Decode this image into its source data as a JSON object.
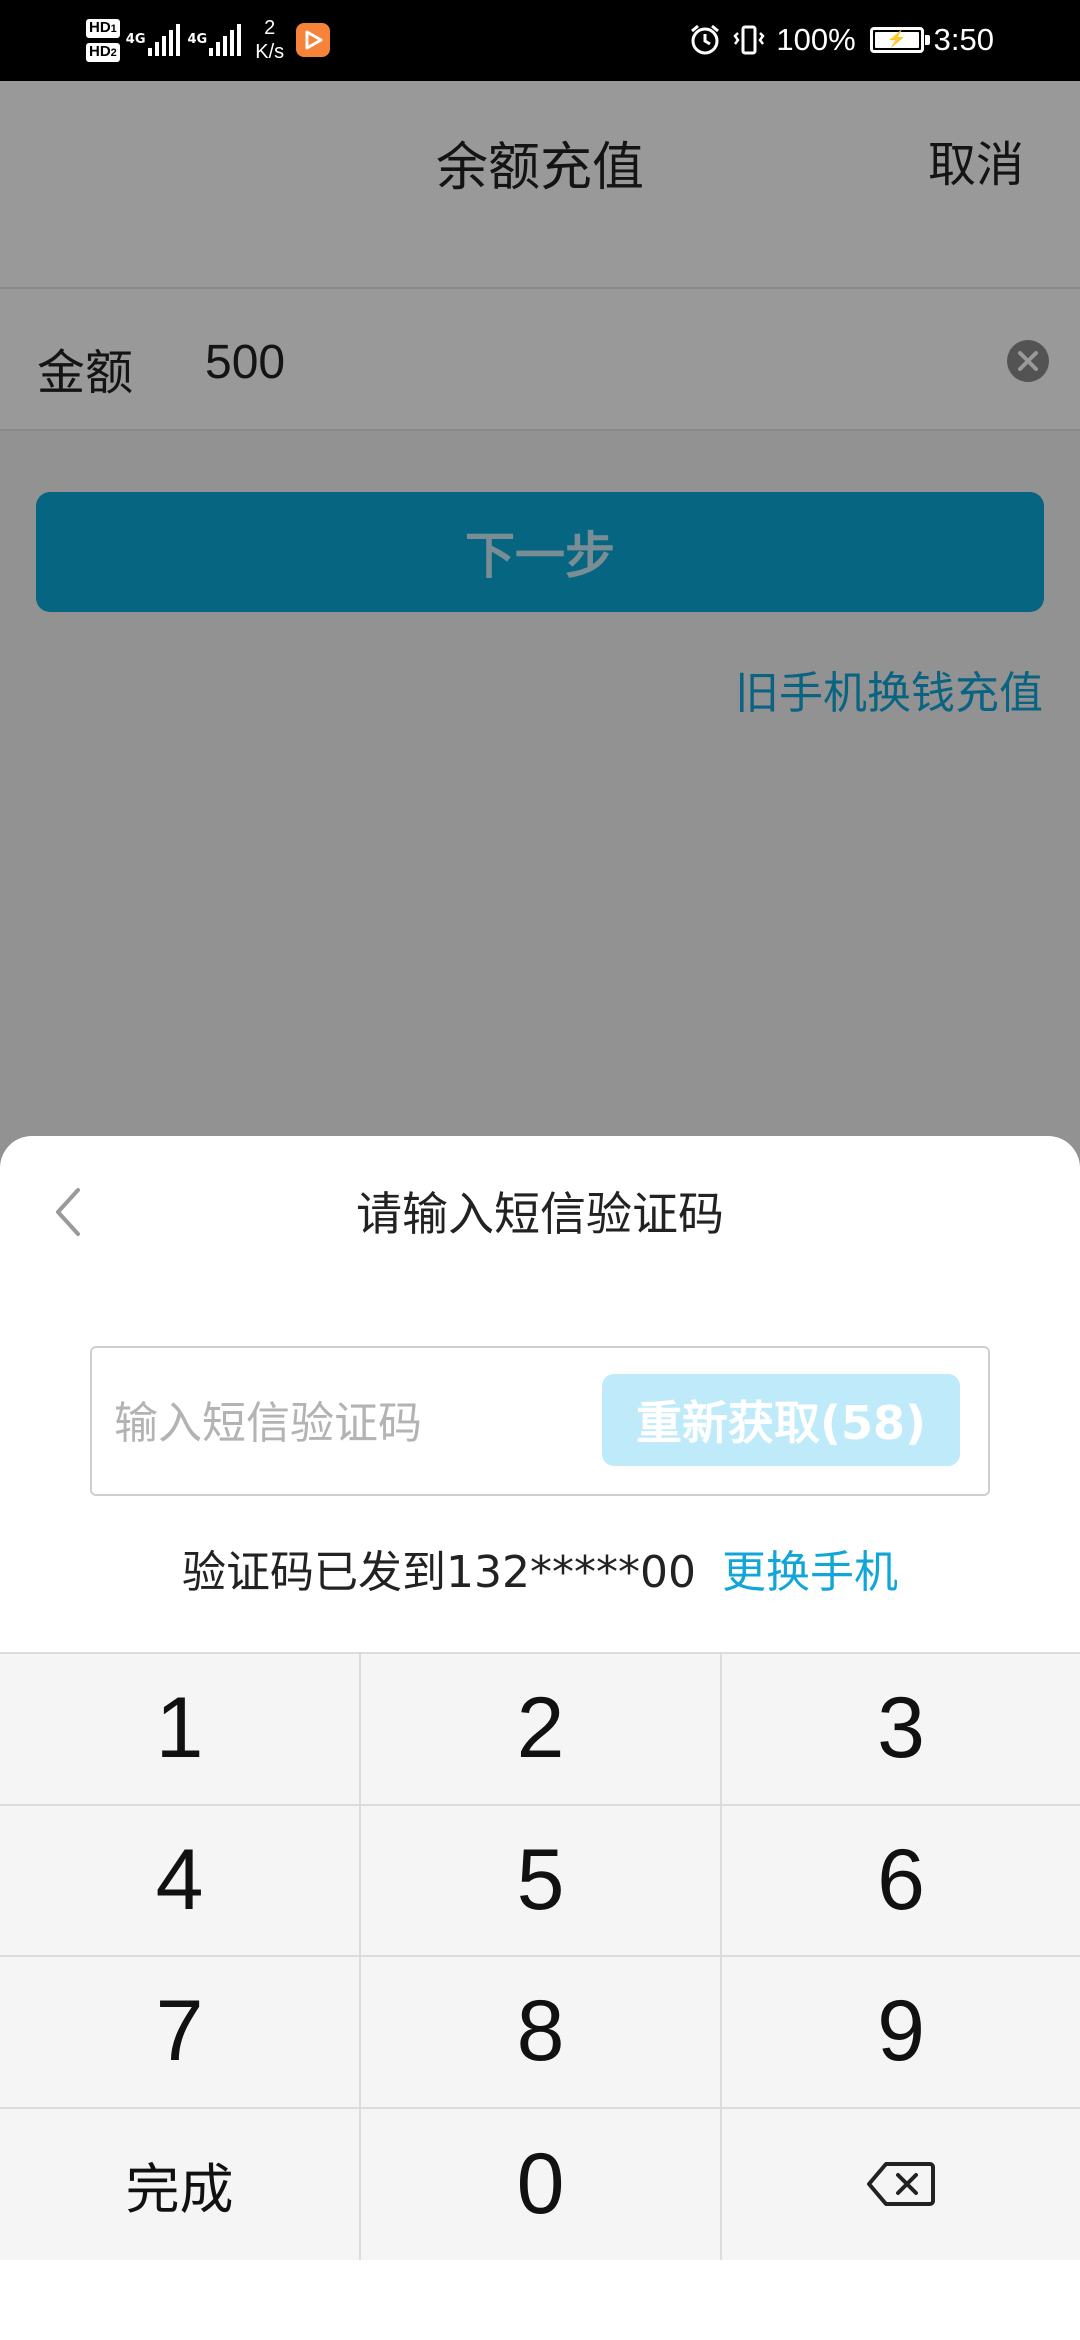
{
  "status_bar": {
    "hd1": "HD",
    "hd1_sub": "1",
    "hd2": "HD",
    "hd2_sub": "2",
    "sim1_net": "4G",
    "sim2_net": "4G",
    "net_speed_value": "2",
    "net_speed_unit": "K/s",
    "battery_percent": "100%",
    "time": "3:50",
    "icons": [
      "alarm-icon",
      "vibrate-icon",
      "battery-icon",
      "app-notification-icon"
    ]
  },
  "background_page": {
    "title": "余额充值",
    "cancel_label": "取消",
    "amount_label": "金额",
    "amount_value": "500",
    "next_button_label": "下一步",
    "old_phone_link": "旧手机换钱充值",
    "accent_color": "#0aaad7"
  },
  "sms_sheet": {
    "title": "请输入短信验证码",
    "code_input_placeholder": "输入短信验证码",
    "code_input_value": "",
    "resend_button_label": "重新获取(58)",
    "sent_text": "验证码已发到132*****00",
    "change_phone_label": "更换手机"
  },
  "keypad": {
    "keys": [
      "1",
      "2",
      "3",
      "4",
      "5",
      "6",
      "7",
      "8",
      "9",
      "完成",
      "0"
    ],
    "backspace_icon": "backspace-icon"
  }
}
